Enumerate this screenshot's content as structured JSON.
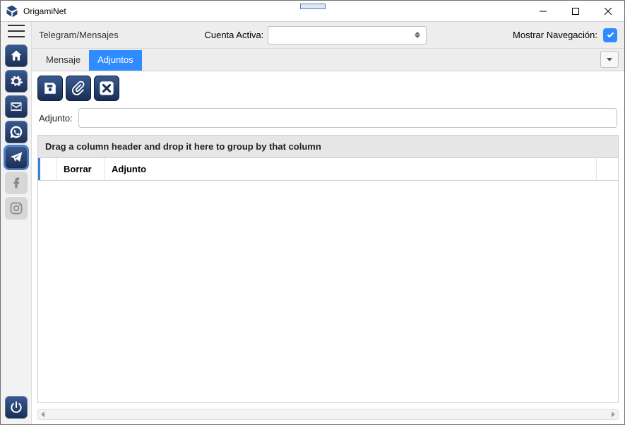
{
  "app": {
    "title": "OrigamiNet"
  },
  "topbar": {
    "breadcrumb": "Telegram/Mensajes",
    "account_label": "Cuenta Activa:",
    "account_value": "",
    "show_nav_label": "Mostrar Navegación:",
    "show_nav_checked": true
  },
  "tabs": {
    "message": "Mensaje",
    "attachments": "Adjuntos",
    "active": "attachments"
  },
  "form": {
    "attachment_label": "Adjunto:",
    "attachment_value": ""
  },
  "grid": {
    "group_hint": "Drag a column header and drop it here to group by that column",
    "columns": {
      "delete": "Borrar",
      "attachment": "Adjunto"
    },
    "rows": []
  }
}
